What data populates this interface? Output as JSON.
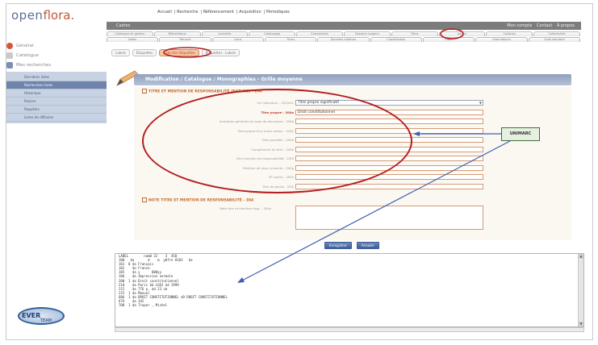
{
  "logo": {
    "part1": "open",
    "part2": "flora."
  },
  "top_nav": [
    "Accueil",
    "Recherche",
    "Référencement",
    "Acquisition",
    "Périodiques"
  ],
  "header": {
    "bar_label": "Cadres",
    "right_links": [
      "Mon compte",
      "Contact",
      "À propos"
    ]
  },
  "tabs_row1": [
    "Catalogue de gestion",
    "Bibliothèque",
    "Autorités",
    "Catalogage",
    "Exemplaires",
    "Dossiers usagers",
    "Titres",
    "Auteur",
    "Collation",
    "Collectivités"
  ],
  "tabs_row2": [
    "Notes",
    "Résumé",
    "Liens",
    "Titres",
    "Données relatives",
    "Classification",
    "Index",
    "International",
    "Code standard"
  ],
  "subtabs": [
    {
      "label": "Labels",
      "active": false
    },
    {
      "label": "Étiquettes",
      "active": false
    },
    {
      "label": "Liste des étiquettes",
      "active": true
    },
    {
      "label": "Étiquettes - Labels",
      "active": false
    }
  ],
  "left_nav": {
    "sections": [
      "Général",
      "Catalogue",
      "Mes recherches"
    ],
    "items": [
      {
        "label": "Dernières listes",
        "active": false
      },
      {
        "label": "Recherches livres",
        "active": true
      },
      {
        "label": "Historique",
        "active": false
      },
      {
        "label": "Paniers",
        "active": false
      },
      {
        "label": "Requêtes",
        "active": false
      },
      {
        "label": "Listes de diffusion",
        "active": false
      }
    ]
  },
  "page_title": "Modification / Catalogue / Monographies - Grille moyenne",
  "section1": {
    "title": "TITRE ET MENTION DE RESPONSABILITÉ (NATURE) - 200",
    "fields": [
      {
        "label": "1er indicateur - 200ind1",
        "value": "Titre propre significatif",
        "required": false,
        "select": true
      },
      {
        "label": "Titre propre - 200a",
        "value": "Droit constitutionnel",
        "required": true,
        "select": false
      },
      {
        "label": "Indication générale du type de document - 200b",
        "value": "",
        "required": false,
        "select": false
      },
      {
        "label": "Titre propre d'un autre auteur - 200c",
        "value": "",
        "required": false,
        "select": false
      },
      {
        "label": "Titre parallèle - 200d",
        "value": "",
        "required": false,
        "select": false
      },
      {
        "label": "Complément du titre - 200e",
        "value": "",
        "required": false,
        "select": false
      },
      {
        "label": "1ère mention de responsabilité - 200f",
        "value": "",
        "required": false,
        "select": false
      },
      {
        "label": "Mention de resp. suivante - 200g",
        "value": "",
        "required": false,
        "select": false
      },
      {
        "label": "N° partie - 200h",
        "value": "",
        "required": false,
        "select": false
      },
      {
        "label": "Titre de partie - 200i",
        "value": "",
        "required": false,
        "select": false
      }
    ]
  },
  "section2": {
    "title": "NOTE TITRE ET MENTION DE RESPONSABILITÉ - 304",
    "field_label": "Note titre et mention resp. - 304a"
  },
  "callout": "UNIMARC",
  "buttons": {
    "primary": "Enregistrer",
    "secondary": "Annuler"
  },
  "marc_lines": [
    "LABEL        nam0 22    3  450",
    "100   $a       d    m  y0fre 8103   ba",
    "101  0 $a Français",
    "102    $a France",
    "105    $a y      000yy",
    "106    $a Impression normale",
    "200  1 $a Droit constitutionnel",
    "210    $a Paris $b LGDJ $d 1999",
    "215    $a 776 p. $d 23 cm",
    "225  1 $a Manuel",
    "606  1 $a DROIT CONSTITUTIONNEL $9 DROIT CONSTITUTIONNEL",
    "676    $a 342",
    "700  1 $a Truper , Michel"
  ],
  "colors": {
    "accent": "#c05a3c",
    "nav_blue": "#6e84ab",
    "title_bar": "#8f9fbd",
    "annotation_red": "#b21d1d"
  }
}
